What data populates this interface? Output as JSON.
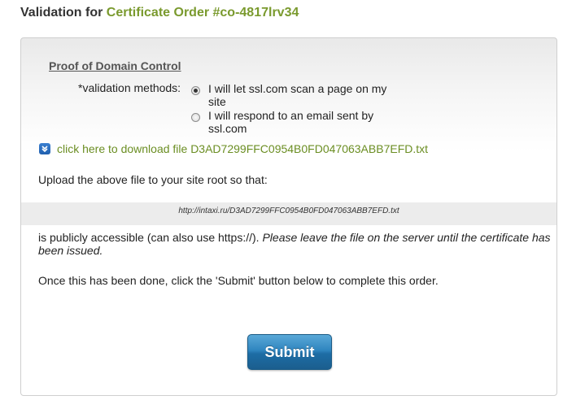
{
  "header": {
    "prefix": "Validation for",
    "order_link": "Certificate Order #co-4817lrv34"
  },
  "proof": {
    "title": "Proof of Domain Control",
    "methods_label": "*validation methods:",
    "options": [
      {
        "label": "I will let ssl.com scan a page on my site",
        "checked": true
      },
      {
        "label": "I will respond to an email sent by ssl.com",
        "checked": false
      }
    ]
  },
  "download": {
    "icon": "chevron-down-icon",
    "link_text": "click here to download file D3AD7299FFC0954B0FD047063ABB7EFD.txt"
  },
  "instructions": {
    "upload": "Upload the above file to your site root so that:",
    "url": "http://intaxi.ru/D3AD7299FFC0954B0FD047063ABB7EFD.txt",
    "accessible": "is publicly accessible (can also use https://).",
    "accessible_note": "Please leave the file on the server until the certificate has been issued.",
    "once_done": "Once this has been done, click the 'Submit' button below to complete this order."
  },
  "submit": {
    "label": "Submit"
  },
  "colors": {
    "link": "#6b8e23",
    "button": "#2f85bf"
  }
}
